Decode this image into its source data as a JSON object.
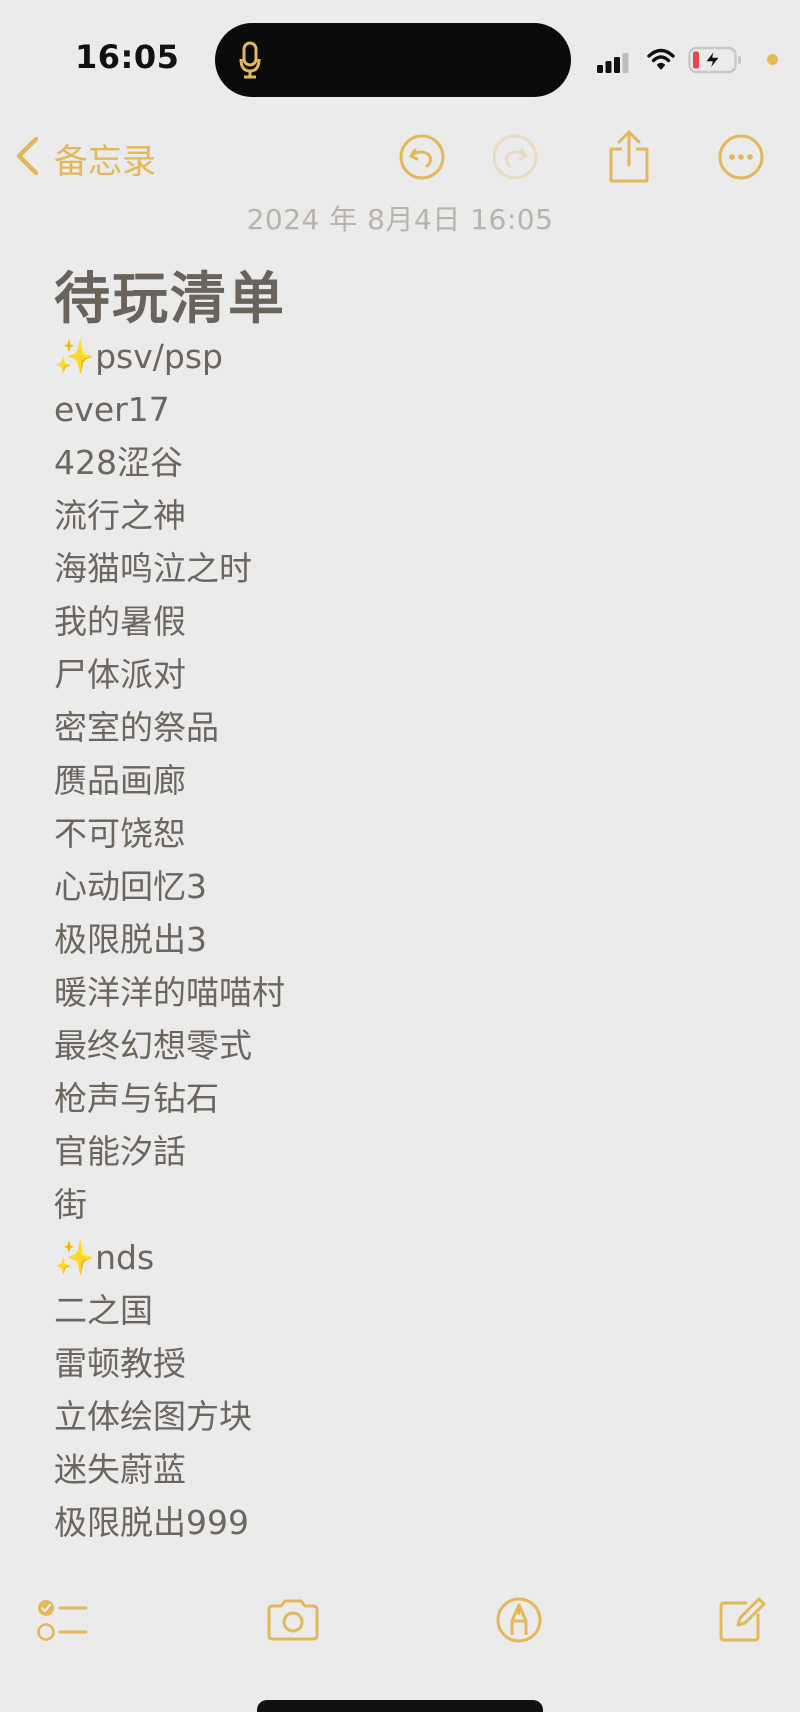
{
  "status_bar": {
    "time": "16:05",
    "icons": [
      "microphone-icon",
      "cellular-signal-icon",
      "wifi-icon",
      "battery-charging-icon",
      "privacy-indicator-dot"
    ]
  },
  "toolbar": {
    "back_label": "备忘录",
    "icons": [
      "chevron-left-icon",
      "undo-icon",
      "redo-icon",
      "share-icon",
      "more-options-icon"
    ]
  },
  "note": {
    "date": "2024 年 8月4日 16:05",
    "title": "待玩清单",
    "lines": [
      "✨psv/psp",
      "ever17",
      "428涩谷",
      "流行之神",
      "海猫鸣泣之时",
      "我的暑假",
      "尸体派对",
      "密室的祭品",
      "赝品画廊",
      "不可饶恕",
      "心动回忆3",
      "极限脱出3",
      "暖洋洋的喵喵村",
      "最终幻想零式",
      "枪声与钻石",
      "官能汐話",
      "街",
      "✨nds",
      "二之国",
      "雷顿教授",
      "立体绘图方块",
      "迷失蔚蓝",
      "极限脱出999"
    ]
  },
  "bottom_bar": {
    "icons": [
      "checklist-icon",
      "camera-icon",
      "markup-pen-icon",
      "compose-icon"
    ]
  },
  "colors": {
    "accent": "#e3b85b",
    "background": "#ebebeb",
    "text": "#6c665f",
    "date_text": "#b8b3ab"
  }
}
